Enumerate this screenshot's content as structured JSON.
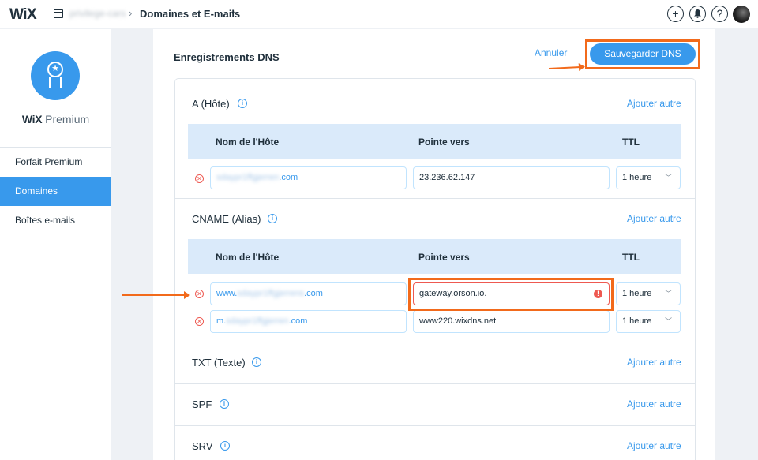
{
  "topbar": {
    "logo": "WiX",
    "site_name": "privilege-cars",
    "breadcrumb_sep": "›",
    "breadcrumb_current": "Domaines et E-mails",
    "caret": "▾",
    "add_icon": "+",
    "notifications_icon": "bell-icon",
    "help_icon": "?"
  },
  "sidebar": {
    "brand_logo": "WiX",
    "brand_name": "Premium",
    "items": [
      {
        "label": "Forfait Premium",
        "active": false
      },
      {
        "label": "Domaines",
        "active": true
      },
      {
        "label": "Boîtes e-mails",
        "active": false
      }
    ]
  },
  "header": {
    "title": "Enregistrements DNS",
    "cancel_label": "Annuler",
    "save_label": "Sauvegarder DNS"
  },
  "columns": {
    "host": "Nom de l'Hôte",
    "target": "Pointe vers",
    "ttl": "TTL"
  },
  "add_label": "Ajouter autre",
  "sections": {
    "a": {
      "title": "A (Hôte)",
      "rows": [
        {
          "host_prefix": "",
          "host_blurred": "sdaypr1ffgjerren",
          "host_suffix": ".com",
          "target": "23.236.62.147",
          "ttl": "1 heure"
        }
      ]
    },
    "cname": {
      "title": "CNAME (Alias)",
      "rows": [
        {
          "host_prefix": "www.",
          "host_blurred": "sdaypr1ffgjerrens",
          "host_suffix": ".com",
          "target": "gateway.orson.io.",
          "ttl": "1 heure",
          "error": true
        },
        {
          "host_prefix": "m.",
          "host_blurred": "sdaypr1ffgjerren",
          "host_suffix": ".com",
          "target": "www220.wixdns.net",
          "ttl": "1 heure",
          "error": false
        }
      ]
    },
    "txt": {
      "title": "TXT (Texte)"
    },
    "spf": {
      "title": "SPF"
    },
    "srv": {
      "title": "SRV"
    }
  },
  "colors": {
    "accent": "#3899ec",
    "header_row": "#daeafa",
    "error": "#ee5951",
    "annotation": "#f26a1b"
  }
}
